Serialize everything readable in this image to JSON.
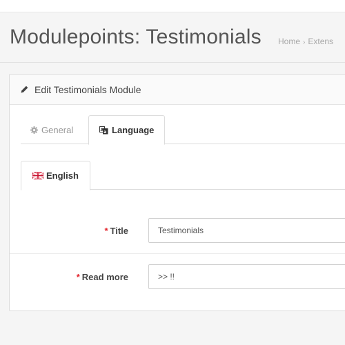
{
  "page": {
    "title": "Modulepoints: Testimonials",
    "breadcrumb": [
      "Home",
      "Extens"
    ],
    "breadcrumb_separator": "›"
  },
  "panel": {
    "title": "Edit Testimonials Module",
    "icon": "pencil-icon"
  },
  "tabs": [
    {
      "label": "General",
      "icon": "cog-icon",
      "active": false
    },
    {
      "label": "Language",
      "icon": "language-icon",
      "active": true
    }
  ],
  "language_tabs": [
    {
      "label": "English",
      "icon": "flag-uk-icon",
      "active": true
    }
  ],
  "form": {
    "title": {
      "label": "Title",
      "required_mark": "*",
      "value": "Testimonials"
    },
    "read_more": {
      "label": "Read more",
      "required_mark": "*",
      "value": ">> !!"
    }
  },
  "colors": {
    "required": "#e3262e",
    "background": "#f5f5f5"
  }
}
